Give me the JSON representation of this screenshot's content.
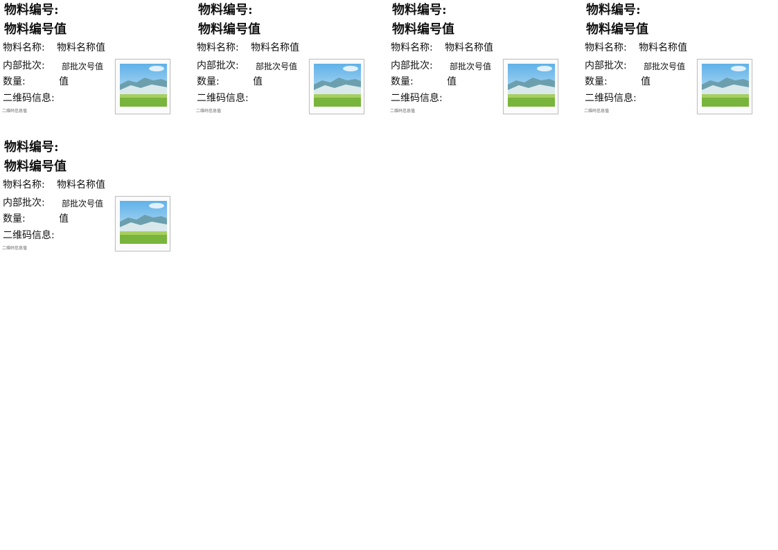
{
  "labels": [
    {
      "code_label": "物料编号:",
      "code_value": "物料编号值",
      "name_label": "物料名称:",
      "name_value": "物料名称值",
      "batch_label": "内部批次:",
      "batch_value": "部批次号值",
      "qty_label": "数量:",
      "qty_value": "值",
      "qr_label": "二维码信息:",
      "qr_value": "二维码信息值",
      "image_icon": "landscape-placeholder-icon"
    },
    {
      "code_label": "物料编号:",
      "code_value": "物料编号值",
      "name_label": "物料名称:",
      "name_value": "物料名称值",
      "batch_label": "内部批次:",
      "batch_value": "部批次号值",
      "qty_label": "数量:",
      "qty_value": "值",
      "qr_label": "二维码信息:",
      "qr_value": "二维码信息值",
      "image_icon": "landscape-placeholder-icon"
    },
    {
      "code_label": "物料编号:",
      "code_value": "物料编号值",
      "name_label": "物料名称:",
      "name_value": "物料名称值",
      "batch_label": "内部批次:",
      "batch_value": "部批次号值",
      "qty_label": "数量:",
      "qty_value": "值",
      "qr_label": "二维码信息:",
      "qr_value": "二维码信息值",
      "image_icon": "landscape-placeholder-icon"
    },
    {
      "code_label": "物料编号:",
      "code_value": "物料编号值",
      "name_label": "物料名称:",
      "name_value": "物料名称值",
      "batch_label": "内部批次:",
      "batch_value": "部批次号值",
      "qty_label": "数量:",
      "qty_value": "值",
      "qr_label": "二维码信息:",
      "qr_value": "二维码信息值",
      "image_icon": "landscape-placeholder-icon"
    },
    {
      "code_label": "物料编号:",
      "code_value": "物料编号值",
      "name_label": "物料名称:",
      "name_value": "物料名称值",
      "batch_label": "内部批次:",
      "batch_value": "部批次号值",
      "qty_label": "数量:",
      "qty_value": "值",
      "qr_label": "二维码信息:",
      "qr_value": "二维码信息值",
      "image_icon": "landscape-placeholder-icon"
    }
  ]
}
